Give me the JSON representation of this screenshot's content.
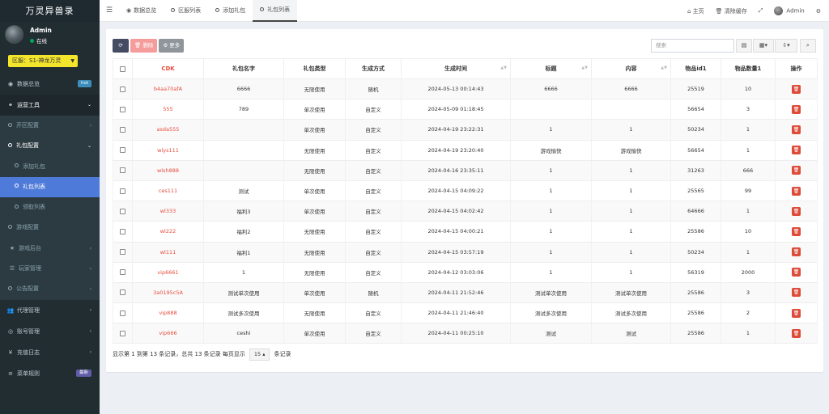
{
  "app": {
    "title": "万灵异兽录"
  },
  "user": {
    "name": "Admin",
    "status": "在线"
  },
  "server": {
    "selected": "区服：S1-神龙万灵"
  },
  "menu": [
    {
      "label": "数据总览",
      "icon": "dashboard-icon",
      "badge": "hot"
    },
    {
      "label": "运营工具",
      "icon": "tools-icon",
      "arrow": "⌄"
    },
    {
      "label": "开区配置",
      "arrow": "‹"
    },
    {
      "label": "礼包配置",
      "arrow": "⌄"
    },
    {
      "label": "添加礼包"
    },
    {
      "label": "礼包列表"
    },
    {
      "label": "领取列表"
    },
    {
      "label": "游戏配置"
    },
    {
      "label": "游戏后台",
      "arrow": "‹"
    },
    {
      "label": "玩家管理",
      "arrow": "‹"
    },
    {
      "label": "公告配置",
      "arrow": "‹"
    },
    {
      "label": "代理管理",
      "arrow": "‹"
    },
    {
      "label": "账号管理",
      "arrow": "‹"
    },
    {
      "label": "充值日志",
      "arrow": "‹"
    },
    {
      "label": "菜单规则",
      "badge": "最新"
    }
  ],
  "tabs": [
    {
      "label": "数据总览"
    },
    {
      "label": "区服列表"
    },
    {
      "label": "添加礼包"
    },
    {
      "label": "礼包列表"
    }
  ],
  "topright": {
    "home": "主页",
    "clear_cache": "清除缓存",
    "admin": "Admin"
  },
  "toolbar": {
    "delete": "删除",
    "more": "更多",
    "search_placeholder": "搜索"
  },
  "table": {
    "headers": [
      "CDK",
      "礼包名字",
      "礼包类型",
      "生成方式",
      "生成时间",
      "标题",
      "内容",
      "物品id1",
      "物品数量1",
      "操作"
    ],
    "rows": [
      [
        "b4aa70afA",
        "6666",
        "无限使用",
        "随机",
        "2024-05-13 00:14:43",
        "6666",
        "6666",
        "25519",
        "10"
      ],
      [
        "555",
        "789",
        "单次使用",
        "自定义",
        "2024-05-09 01:18:45",
        "",
        "",
        "56654",
        "3"
      ],
      [
        "asda555",
        "",
        "单次使用",
        "自定义",
        "2024-04-19 23:22:31",
        "1",
        "1",
        "50234",
        "1"
      ],
      [
        "wlys111",
        "",
        "无限使用",
        "自定义",
        "2024-04-19 23:20:40",
        "游戏愉快",
        "游戏愉快",
        "56654",
        "1"
      ],
      [
        "wlsh888",
        "",
        "无限使用",
        "自定义",
        "2024-04-16 23:35:11",
        "1",
        "1",
        "31263",
        "666"
      ],
      [
        "ces111",
        "测试",
        "单次使用",
        "自定义",
        "2024-04-15 04:09:22",
        "1",
        "1",
        "25565",
        "99"
      ],
      [
        "wl333",
        "福利3",
        "单次使用",
        "自定义",
        "2024-04-15 04:02:42",
        "1",
        "1",
        "64666",
        "1"
      ],
      [
        "wl222",
        "福利2",
        "无限使用",
        "自定义",
        "2024-04-15 04:00:21",
        "1",
        "1",
        "25586",
        "10"
      ],
      [
        "wl111",
        "福利1",
        "无限使用",
        "自定义",
        "2024-04-15 03:57:19",
        "1",
        "1",
        "50234",
        "1"
      ],
      [
        "vip6661",
        "1",
        "无限使用",
        "自定义",
        "2024-04-12 03:03:06",
        "1",
        "1",
        "56319",
        "2000"
      ],
      [
        "3a0195c5A",
        "测试单次使用",
        "单次使用",
        "随机",
        "2024-04-11 21:52:46",
        "测试单次使用",
        "测试单次使用",
        "25586",
        "3"
      ],
      [
        "vip888",
        "测试多次使用",
        "无限使用",
        "自定义",
        "2024-04-11 21:46:40",
        "测试多次使用",
        "测试多次使用",
        "25586",
        "2"
      ],
      [
        "vip666",
        "ceshi",
        "单次使用",
        "自定义",
        "2024-04-11 00:25:10",
        "测试",
        "测试",
        "25586",
        "1"
      ]
    ]
  },
  "footer": {
    "summary": "显示第 1 到第 13 条记录，总共 13 条记录 每页显示",
    "page_size": "15",
    "suffix": "条记录"
  },
  "colors": {
    "sidebar_bg": "#222d32",
    "accent": "#4e7ad9",
    "danger": "#dd4b39",
    "server_select": "#f3e42c"
  }
}
